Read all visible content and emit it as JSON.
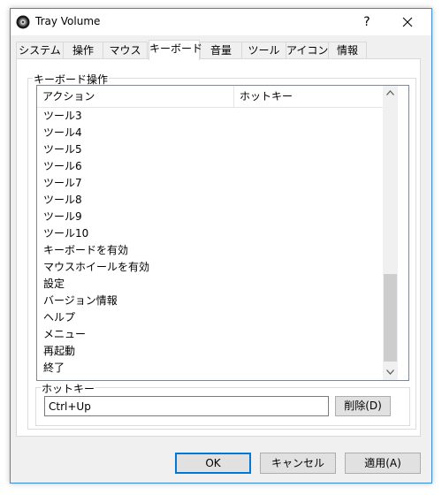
{
  "window": {
    "title": "Tray Volume",
    "help_label": "?"
  },
  "tabs": [
    {
      "label": "システム"
    },
    {
      "label": "操作"
    },
    {
      "label": "マウス"
    },
    {
      "label": "キーボード"
    },
    {
      "label": "音量"
    },
    {
      "label": "ツール"
    },
    {
      "label": "アイコン"
    },
    {
      "label": "情報"
    }
  ],
  "active_tab": "キーボード",
  "keyboard": {
    "group_label": "キーボード操作",
    "columns": [
      "アクション",
      "ホットキー"
    ],
    "rows": [
      "ツール3",
      "ツール4",
      "ツール5",
      "ツール6",
      "ツール7",
      "ツール8",
      "ツール9",
      "ツール10",
      "キーボードを有効",
      "マウスホイールを有効",
      "設定",
      "バージョン情報",
      "ヘルプ",
      "メニュー",
      "再起動",
      "終了"
    ],
    "scroll_position": 1.0
  },
  "hotkey": {
    "group_label": "ホットキー",
    "value": "Ctrl+Up",
    "delete_label": "削除(D)"
  },
  "footer": {
    "ok_label": "OK",
    "cancel_label": "キャンセル",
    "apply_label": "適用(A)"
  },
  "colors": {
    "accent": "#0078d7",
    "window_border": "#3c8ad8",
    "dialog_bg": "#f0f0f0"
  }
}
